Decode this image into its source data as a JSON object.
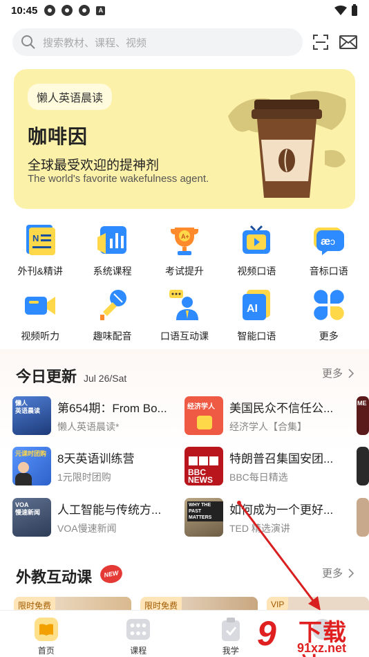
{
  "status_bar": {
    "time": "10:45",
    "a_icon": "A"
  },
  "search": {
    "placeholder": "搜索教材、课程、视频"
  },
  "banner": {
    "tag": "懒人英语晨读",
    "title": "咖啡因",
    "subtitle_cn": "全球最受欢迎的提神剂",
    "subtitle_en": "The world's favorite wakefulness agent."
  },
  "categories": [
    {
      "label": "外刊&精讲",
      "icon": "newspaper-icon"
    },
    {
      "label": "系统课程",
      "icon": "chart-bars-icon"
    },
    {
      "label": "考试提升",
      "icon": "trophy-icon"
    },
    {
      "label": "视频口语",
      "icon": "tv-play-icon"
    },
    {
      "label": "音标口语",
      "icon": "phonetic-icon"
    },
    {
      "label": "视频听力",
      "icon": "video-camera-icon"
    },
    {
      "label": "趣味配音",
      "icon": "microphone-icon"
    },
    {
      "label": "口语互动课",
      "icon": "teacher-icon"
    },
    {
      "label": "智能口语",
      "icon": "ai-icon"
    },
    {
      "label": "更多",
      "icon": "clover-icon"
    }
  ],
  "today": {
    "title": "今日更新",
    "date": "Jul 26/Sat",
    "more": "更多",
    "items": [
      {
        "title": "第654期：From Bo...",
        "source": "懒人英语晨读*",
        "thumb_text": "懒人\n英语晨读",
        "color": "#2f5aa8"
      },
      {
        "title": "美国民众不信任公...",
        "source": "经济学人【合集】",
        "thumb_text": "经济学人",
        "color": "#e94b3c"
      },
      {
        "title": "8天英语训练营",
        "source": "1元限时团购",
        "thumb_text": "元课时团购",
        "color": "#3f77d6"
      },
      {
        "title": "特朗普召集国安团...",
        "source": "BBC每日精选",
        "thumb_text": "BBC NEWS",
        "color": "#b8161c"
      },
      {
        "title": "人工智能与传统方...",
        "source": "VOA慢速新闻",
        "thumb_text": "VOA\n慢速新闻",
        "color": "#3d4f6e"
      },
      {
        "title": "如何成为一个更好...",
        "source": "TED 精选演讲",
        "thumb_text": "WHY THE\nPAST MATTERS",
        "color": "#9a8a6c"
      }
    ],
    "side_thumbs_text": [
      "ME",
      "",
      ""
    ]
  },
  "foreign": {
    "title": "外教互动课",
    "badge": "NEW",
    "more": "更多",
    "cards": [
      {
        "badge": "限时免费"
      },
      {
        "badge": "限时免费"
      },
      {
        "badge": "VIP"
      }
    ]
  },
  "nav": [
    {
      "label": "首页",
      "icon": "home-book-icon"
    },
    {
      "label": "课程",
      "icon": "grid-course-icon"
    },
    {
      "label": "我学",
      "icon": "clipboard-check-icon"
    },
    {
      "label": "",
      "icon": "profile-icon"
    }
  ],
  "watermark": {
    "brand": "下载站",
    "site": "91xz.net",
    "mark": "9"
  },
  "colors": {
    "banner_bg": "#fcf1a8",
    "accent_blue": "#2e8bff",
    "brand_red": "#e02020"
  }
}
